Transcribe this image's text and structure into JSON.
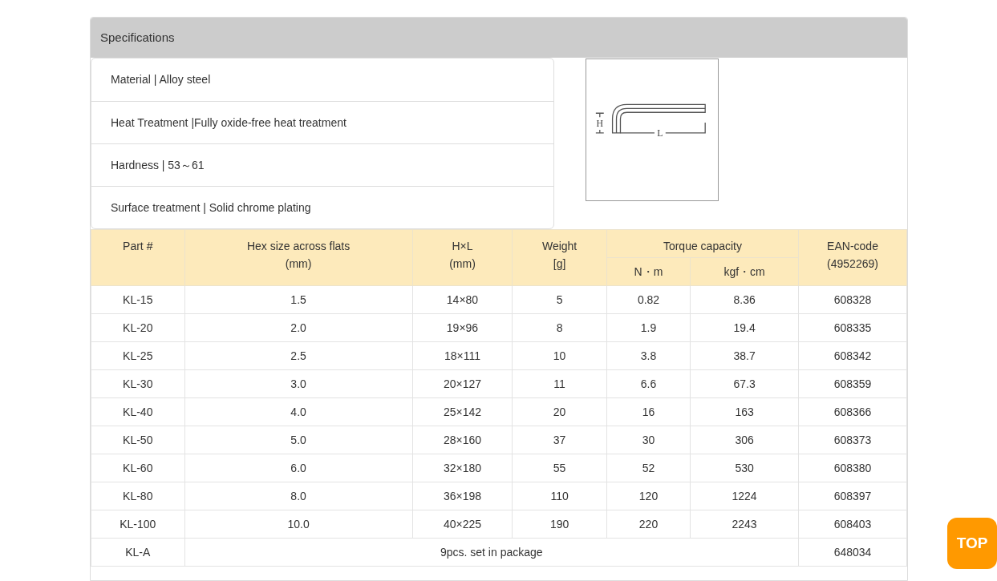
{
  "panel": {
    "title": "Specifications"
  },
  "specs": [
    "Material | Alloy steel",
    "Heat Treatment |Fully oxide-free heat treatment",
    "Hardness | 53～61",
    "Surface treatment | Solid chrome plating"
  ],
  "diagram": {
    "labels": [
      "H",
      "L"
    ]
  },
  "table": {
    "columns": [
      {
        "lines": [
          "Part #"
        ]
      },
      {
        "lines": [
          "Hex size across flats",
          "(mm)"
        ]
      },
      {
        "lines": [
          "H×L",
          "(mm)"
        ]
      },
      {
        "lines": [
          "Weight",
          "[g]"
        ]
      },
      {
        "lines": [
          "Torque capacity"
        ],
        "colspan": 2,
        "children": [
          "N・m",
          "kgf・cm"
        ]
      },
      {
        "lines": [
          "EAN-code",
          "(4952269)"
        ]
      }
    ],
    "rows": [
      {
        "kind": "item",
        "cells": [
          "KL-15",
          "1.5",
          "14×80",
          "5",
          "0.82",
          "8.36",
          "608328"
        ]
      },
      {
        "kind": "item",
        "cells": [
          "KL-20",
          "2.0",
          "19×96",
          "8",
          "1.9",
          "19.4",
          "608335"
        ]
      },
      {
        "kind": "item",
        "cells": [
          "KL-25",
          "2.5",
          "18×111",
          "10",
          "3.8",
          "38.7",
          "608342"
        ]
      },
      {
        "kind": "item",
        "cells": [
          "KL-30",
          "3.0",
          "20×127",
          "11",
          "6.6",
          "67.3",
          "608359"
        ]
      },
      {
        "kind": "item",
        "cells": [
          "KL-40",
          "4.0",
          "25×142",
          "20",
          "16",
          "163",
          "608366"
        ]
      },
      {
        "kind": "item",
        "cells": [
          "KL-50",
          "5.0",
          "28×160",
          "37",
          "30",
          "306",
          "608373"
        ]
      },
      {
        "kind": "item",
        "cells": [
          "KL-60",
          "6.0",
          "32×180",
          "55",
          "52",
          "530",
          "608380"
        ]
      },
      {
        "kind": "item",
        "cells": [
          "KL-80",
          "8.0",
          "36×198",
          "110",
          "120",
          "1224",
          "608397"
        ]
      },
      {
        "kind": "item",
        "cells": [
          "KL-100",
          "10.0",
          "40×225",
          "190",
          "220",
          "2243",
          "608403"
        ]
      },
      {
        "kind": "set",
        "cells": [
          {
            "text": "KL-A"
          },
          {
            "text": "9pcs. set in package",
            "colspan": 5
          },
          {
            "text": "648034"
          }
        ]
      }
    ]
  },
  "top_button": "TOP"
}
